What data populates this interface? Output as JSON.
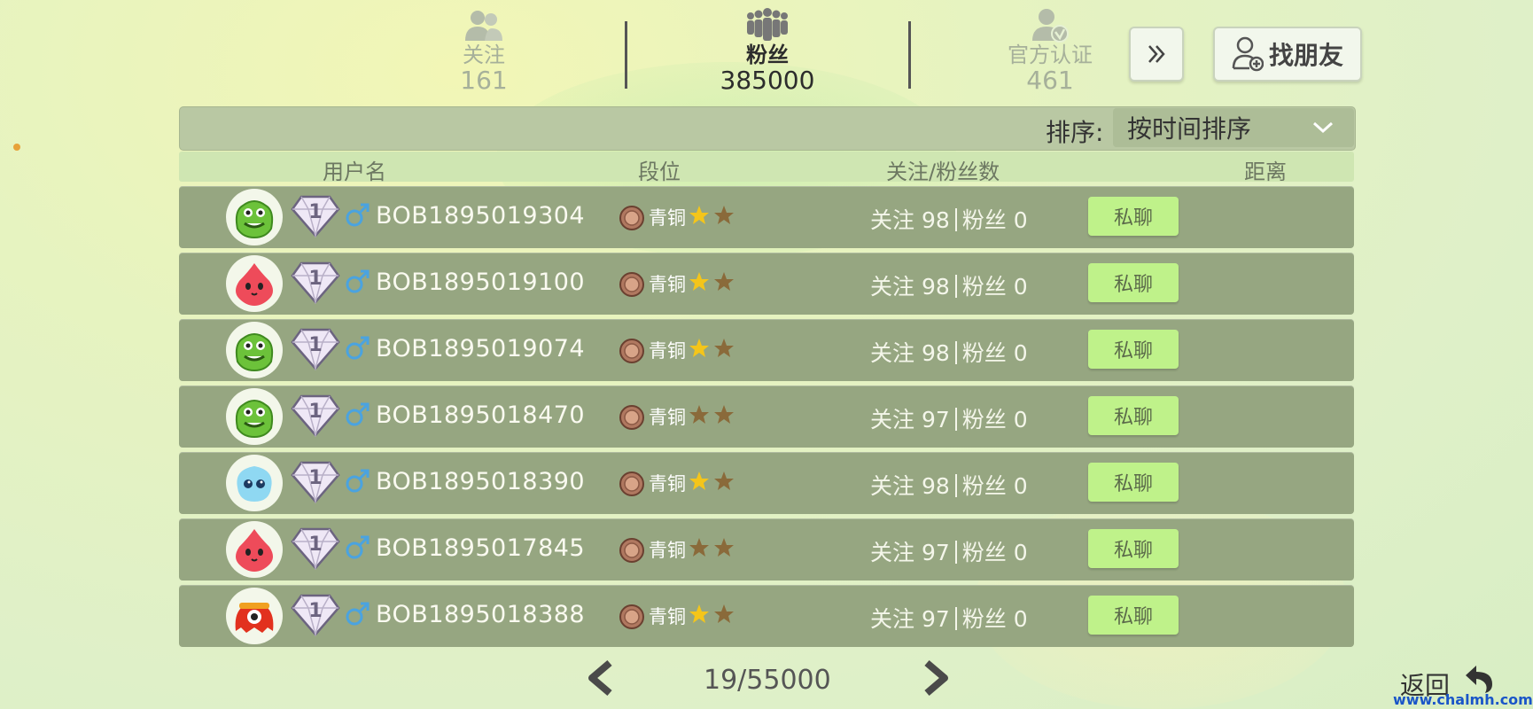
{
  "tabs": [
    {
      "label": "关注",
      "count": "161",
      "icon": "users-icon",
      "active": false
    },
    {
      "label": "粉丝",
      "count": "385000",
      "icon": "crowd-icon",
      "active": true
    },
    {
      "label": "官方认证",
      "count": "461",
      "icon": "verified-user-icon",
      "active": false
    }
  ],
  "toolbar": {
    "more_icon": "double-chevron-right-icon",
    "find_friends_label": "找朋友",
    "find_friends_icon": "add-user-icon"
  },
  "sort": {
    "label": "排序:",
    "selected": "按时间排序"
  },
  "columns": {
    "username": "用户名",
    "rank": "段位",
    "follow_fans": "关注/粉丝数",
    "distance": "距离"
  },
  "rows": [
    {
      "avatar": "green-monster",
      "level": "1",
      "gender": "male",
      "username": "BOB1895019304",
      "rank": "青铜",
      "stars_filled": 1,
      "follow_label": "关注",
      "follow": "98",
      "fans_label": "粉丝",
      "fans": "0",
      "chat_label": "私聊"
    },
    {
      "avatar": "red-blob",
      "level": "1",
      "gender": "male",
      "username": "BOB1895019100",
      "rank": "青铜",
      "stars_filled": 1,
      "follow_label": "关注",
      "follow": "98",
      "fans_label": "粉丝",
      "fans": "0",
      "chat_label": "私聊"
    },
    {
      "avatar": "green-monster",
      "level": "1",
      "gender": "male",
      "username": "BOB1895019074",
      "rank": "青铜",
      "stars_filled": 1,
      "follow_label": "关注",
      "follow": "98",
      "fans_label": "粉丝",
      "fans": "0",
      "chat_label": "私聊"
    },
    {
      "avatar": "green-monster",
      "level": "1",
      "gender": "male",
      "username": "BOB1895018470",
      "rank": "青铜",
      "stars_filled": 0,
      "follow_label": "关注",
      "follow": "97",
      "fans_label": "粉丝",
      "fans": "0",
      "chat_label": "私聊"
    },
    {
      "avatar": "blue-blob",
      "level": "1",
      "gender": "male",
      "username": "BOB1895018390",
      "rank": "青铜",
      "stars_filled": 1,
      "follow_label": "关注",
      "follow": "98",
      "fans_label": "粉丝",
      "fans": "0",
      "chat_label": "私聊"
    },
    {
      "avatar": "red-blob",
      "level": "1",
      "gender": "male",
      "username": "BOB1895017845",
      "rank": "青铜",
      "stars_filled": 0,
      "follow_label": "关注",
      "follow": "97",
      "fans_label": "粉丝",
      "fans": "0",
      "chat_label": "私聊"
    },
    {
      "avatar": "red-octopus",
      "level": "1",
      "gender": "male",
      "username": "BOB1895018388",
      "rank": "青铜",
      "stars_filled": 1,
      "follow_label": "关注",
      "follow": "97",
      "fans_label": "粉丝",
      "fans": "0",
      "chat_label": "私聊"
    }
  ],
  "pagination": {
    "current": "19",
    "total": "55000",
    "text": "19/55000"
  },
  "back_label": "返回",
  "watermark": "www.chalmh.com",
  "colors": {
    "row_bg": "#96a681",
    "chat_button": "#bff28a",
    "star_filled": "#f4c51a",
    "star_empty": "#8a6a3a",
    "male_icon": "#4aa3e0"
  }
}
